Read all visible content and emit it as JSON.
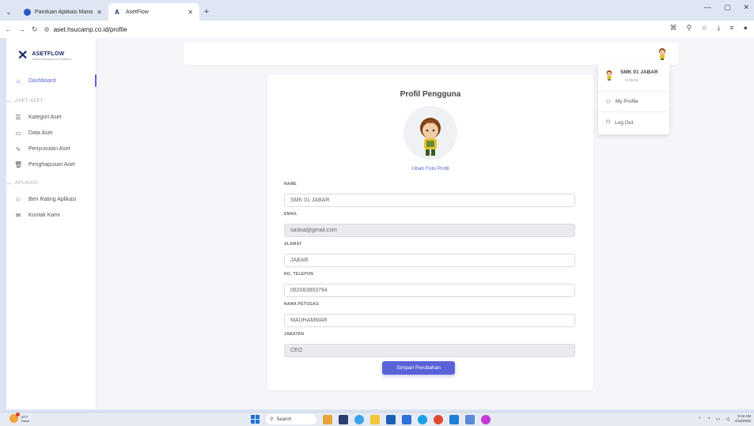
{
  "browser": {
    "tabs": [
      {
        "title": "Panduan Aplikasi Manajemen A",
        "active": false
      },
      {
        "title": "AsetFlow",
        "active": true
      }
    ],
    "url": "aset.hsucamp.co.id/profile",
    "new_tab_symbol": "+",
    "window_controls": [
      "—",
      "▢",
      "✕"
    ]
  },
  "brand": {
    "name": "ASETFLOW",
    "tagline": "Asset Management Platform"
  },
  "sidebar": {
    "items": [
      {
        "label": "Dashboard",
        "icon": "home-icon",
        "glyph": "⌂",
        "active": true
      }
    ],
    "section_aset": "ASET-ASET",
    "aset_items": [
      {
        "label": "Kategori Aset",
        "icon": "list-icon",
        "glyph": "☰"
      },
      {
        "label": "Data Aset",
        "icon": "folder-icon",
        "glyph": "▭"
      },
      {
        "label": "Penyusutan Aset",
        "icon": "chart-icon",
        "glyph": "∿"
      },
      {
        "label": "Penghapusan Aset",
        "icon": "trash-icon",
        "glyph": "🗑"
      }
    ],
    "section_aplikasi": "APLIKASI",
    "app_items": [
      {
        "label": "Beri Rating Aplikasi",
        "icon": "star-icon",
        "glyph": "☆"
      },
      {
        "label": "Kontak Kami",
        "icon": "mail-icon",
        "glyph": "✉"
      }
    ]
  },
  "dropdown": {
    "user_name": "SMK 01 JABAR",
    "user_role": "Instansi",
    "my_profile": "My Profile",
    "logout": "Log Out"
  },
  "profile": {
    "title": "Profil Pengguna",
    "change_photo": "Ubah Foto Profil",
    "fields": [
      {
        "label": "NAME",
        "value": "SMK 01 JABAR",
        "readonly": false
      },
      {
        "label": "EMAIL",
        "value": "saskia@gmail.com",
        "readonly": true
      },
      {
        "label": "ALAMAT",
        "value": "JABAR",
        "readonly": false
      },
      {
        "label": "NO. TELEPON",
        "value": "082083893794",
        "readonly": false
      },
      {
        "label": "NAMA PETUGAS",
        "value": "MAUHAMMAR",
        "readonly": false
      },
      {
        "label": "JABATAN",
        "value": "CEO",
        "readonly": true
      }
    ],
    "save_label": "Simpan Perubahan"
  },
  "taskbar": {
    "weather_temp": "84°F",
    "weather_desc": "Hazel",
    "search_placeholder": "Search",
    "time": "9:42 AM",
    "date": "4/16/2025"
  },
  "colors": {
    "accent": "#5a62d8",
    "brand": "#1b2a6b"
  }
}
